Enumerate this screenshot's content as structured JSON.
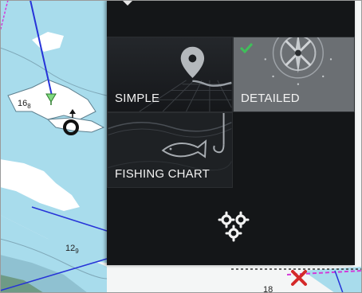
{
  "map": {
    "soundings": [
      "16",
      "8",
      "12",
      "9",
      "18"
    ]
  },
  "chart_mode_menu": {
    "options": [
      {
        "label": "SIMPLE",
        "selected": false,
        "icon": "location-pin-icon"
      },
      {
        "label": "DETAILED",
        "selected": true,
        "icon": "compass-rose-icon"
      },
      {
        "label": "FISHING CHART",
        "selected": false,
        "icon": "fish-hook-icon"
      }
    ],
    "settings_icon": "gears-icon"
  },
  "colors": {
    "panel_bg": "#141618",
    "selected_tile": "#6b6f73",
    "check_green": "#3fbf5a",
    "shallow_water": "#a8dcec",
    "deep_water": "#f4f6f6",
    "land": "#ffffff",
    "route_magenta": "#d43ad8"
  }
}
